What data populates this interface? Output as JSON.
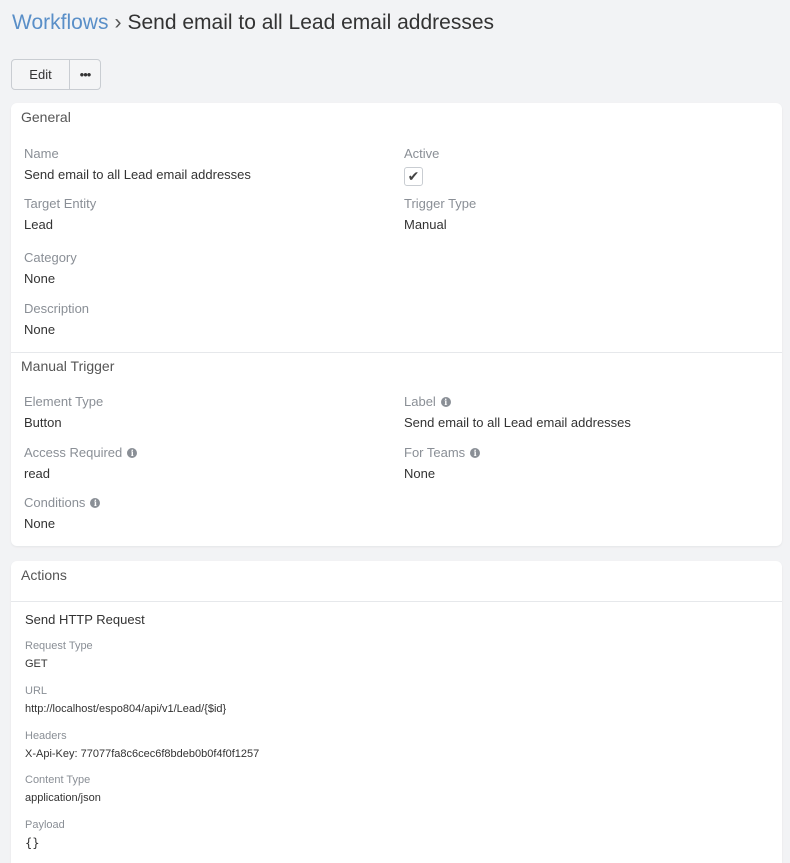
{
  "header": {
    "breadcrumb_root": "Workflows",
    "separator": "›",
    "title": "Send email to all Lead email addresses"
  },
  "toolbar": {
    "edit_label": "Edit",
    "more_label": "•••"
  },
  "general": {
    "title": "General",
    "name": {
      "label": "Name",
      "value": "Send email to all Lead email addresses"
    },
    "active": {
      "label": "Active",
      "checked": true,
      "mark": "✔"
    },
    "target_entity": {
      "label": "Target Entity",
      "value": "Lead"
    },
    "trigger_type": {
      "label": "Trigger Type",
      "value": "Manual"
    },
    "category": {
      "label": "Category",
      "value": "None"
    },
    "description": {
      "label": "Description",
      "value": "None"
    }
  },
  "manual_trigger": {
    "title": "Manual Trigger",
    "element_type": {
      "label": "Element Type",
      "value": "Button"
    },
    "label": {
      "label": "Label",
      "value": "Send email to all Lead email addresses"
    },
    "access_required": {
      "label": "Access Required",
      "value": "read"
    },
    "for_teams": {
      "label": "For Teams",
      "value": "None"
    },
    "conditions": {
      "label": "Conditions",
      "value": "None"
    },
    "info_glyph": "i"
  },
  "actions": {
    "title": "Actions",
    "action": {
      "title": "Send HTTP Request",
      "request_type": {
        "label": "Request Type",
        "value": "GET"
      },
      "url": {
        "label": "URL",
        "value": "http://localhost/espo804/api/v1/Lead/{$id}"
      },
      "headers": {
        "label": "Headers",
        "value": "X-Api-Key: 77077fa8c6cec6f8bdeb0b0f4f0f1257"
      },
      "content_type": {
        "label": "Content Type",
        "value": "application/json"
      },
      "payload": {
        "label": "Payload",
        "value": "{}"
      }
    }
  },
  "colors": {
    "link": "#5a8fc8",
    "background": "#f2f3f5",
    "label": "#8a8f96"
  }
}
